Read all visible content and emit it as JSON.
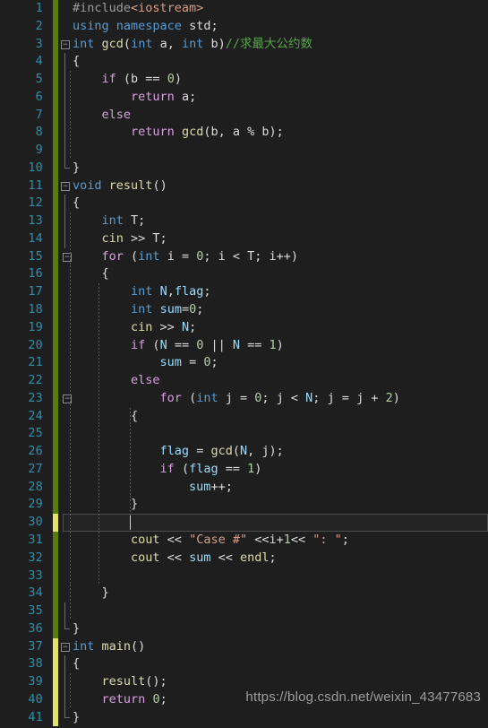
{
  "editor": {
    "first_line": 1,
    "last_line": 41,
    "total_lines": 41,
    "active_line": 30,
    "background": "#1e1e1e",
    "line_number_color": "#2b91af",
    "change_bar_saved_color": "#587c0c",
    "change_bar_unsaved_color": "#e2e26a"
  },
  "watermark": {
    "text": "https://blog.csdn.net/weixin_43477683"
  },
  "lines": [
    {
      "n": 1,
      "chg": "saved",
      "fold": "",
      "indent": 0,
      "tokens": [
        {
          "t": "#include",
          "c": "pre"
        },
        {
          "t": "<iostream>",
          "c": "inc"
        }
      ]
    },
    {
      "n": 2,
      "chg": "saved",
      "fold": "",
      "indent": 0,
      "tokens": [
        {
          "t": "using",
          "c": "kw"
        },
        {
          "t": " ",
          "c": "pun"
        },
        {
          "t": "namespace",
          "c": "kw"
        },
        {
          "t": " std;",
          "c": "pun"
        }
      ]
    },
    {
      "n": 3,
      "chg": "saved",
      "fold": "open",
      "indent": 0,
      "tokens": [
        {
          "t": "int",
          "c": "kw"
        },
        {
          "t": " ",
          "c": "pun"
        },
        {
          "t": "gcd",
          "c": "fn"
        },
        {
          "t": "(",
          "c": "pun"
        },
        {
          "t": "int",
          "c": "kw"
        },
        {
          "t": " a, ",
          "c": "pun"
        },
        {
          "t": "int",
          "c": "kw"
        },
        {
          "t": " b)",
          "c": "pun"
        },
        {
          "t": "//求最大公约数",
          "c": "cmt"
        }
      ]
    },
    {
      "n": 4,
      "chg": "saved",
      "fold": "bar",
      "indent": 0,
      "tokens": [
        {
          "t": "{",
          "c": "pun"
        }
      ]
    },
    {
      "n": 5,
      "chg": "saved",
      "fold": "bar",
      "indent": 1,
      "tokens": [
        {
          "t": "    ",
          "c": "pun"
        },
        {
          "t": "if",
          "c": "ctl"
        },
        {
          "t": " (b ",
          "c": "pun"
        },
        {
          "t": "==",
          "c": "pun"
        },
        {
          "t": " ",
          "c": "pun"
        },
        {
          "t": "0",
          "c": "num"
        },
        {
          "t": ")",
          "c": "pun"
        }
      ]
    },
    {
      "n": 6,
      "chg": "saved",
      "fold": "bar",
      "indent": 1,
      "tokens": [
        {
          "t": "        ",
          "c": "pun"
        },
        {
          "t": "return",
          "c": "ctl"
        },
        {
          "t": " a;",
          "c": "pun"
        }
      ]
    },
    {
      "n": 7,
      "chg": "saved",
      "fold": "bar",
      "indent": 1,
      "tokens": [
        {
          "t": "    ",
          "c": "pun"
        },
        {
          "t": "else",
          "c": "ctl"
        }
      ]
    },
    {
      "n": 8,
      "chg": "saved",
      "fold": "bar",
      "indent": 1,
      "tokens": [
        {
          "t": "        ",
          "c": "pun"
        },
        {
          "t": "return",
          "c": "ctl"
        },
        {
          "t": " ",
          "c": "pun"
        },
        {
          "t": "gcd",
          "c": "fn"
        },
        {
          "t": "(b, a % b);",
          "c": "pun"
        }
      ]
    },
    {
      "n": 9,
      "chg": "saved",
      "fold": "bar",
      "indent": 1,
      "tokens": []
    },
    {
      "n": 10,
      "chg": "saved",
      "fold": "end",
      "indent": 0,
      "tokens": [
        {
          "t": "}",
          "c": "pun"
        }
      ]
    },
    {
      "n": 11,
      "chg": "saved",
      "fold": "open",
      "indent": 0,
      "tokens": [
        {
          "t": "void",
          "c": "kw"
        },
        {
          "t": " ",
          "c": "pun"
        },
        {
          "t": "result",
          "c": "fn"
        },
        {
          "t": "()",
          "c": "pun"
        }
      ]
    },
    {
      "n": 12,
      "chg": "saved",
      "fold": "bar",
      "indent": 0,
      "tokens": [
        {
          "t": "{",
          "c": "pun"
        }
      ]
    },
    {
      "n": 13,
      "chg": "saved",
      "fold": "bar",
      "indent": 1,
      "tokens": [
        {
          "t": "    ",
          "c": "pun"
        },
        {
          "t": "int",
          "c": "kw"
        },
        {
          "t": " T;",
          "c": "pun"
        }
      ]
    },
    {
      "n": 14,
      "chg": "saved",
      "fold": "bar",
      "indent": 1,
      "tokens": [
        {
          "t": "    ",
          "c": "pun"
        },
        {
          "t": "cin",
          "c": "fn"
        },
        {
          "t": " >> T;",
          "c": "pun"
        }
      ]
    },
    {
      "n": 15,
      "chg": "saved",
      "fold": "open2",
      "indent": 1,
      "tokens": [
        {
          "t": "    ",
          "c": "pun"
        },
        {
          "t": "for",
          "c": "ctl"
        },
        {
          "t": " (",
          "c": "pun"
        },
        {
          "t": "int",
          "c": "kw"
        },
        {
          "t": " i = ",
          "c": "pun"
        },
        {
          "t": "0",
          "c": "num"
        },
        {
          "t": "; i < T; i++)",
          "c": "pun"
        }
      ]
    },
    {
      "n": 16,
      "chg": "saved",
      "fold": "bar2",
      "indent": 1,
      "tokens": [
        {
          "t": "    ",
          "c": "pun"
        },
        {
          "t": "{",
          "c": "pun"
        }
      ]
    },
    {
      "n": 17,
      "chg": "saved",
      "fold": "bar2",
      "indent": 2,
      "tokens": [
        {
          "t": "        ",
          "c": "pun"
        },
        {
          "t": "int",
          "c": "kw"
        },
        {
          "t": " ",
          "c": "pun"
        },
        {
          "t": "N",
          "c": "var"
        },
        {
          "t": ",",
          "c": "pun"
        },
        {
          "t": "flag",
          "c": "var"
        },
        {
          "t": ";",
          "c": "pun"
        }
      ]
    },
    {
      "n": 18,
      "chg": "saved",
      "fold": "bar2",
      "indent": 2,
      "tokens": [
        {
          "t": "        ",
          "c": "pun"
        },
        {
          "t": "int",
          "c": "kw"
        },
        {
          "t": " ",
          "c": "pun"
        },
        {
          "t": "sum",
          "c": "var"
        },
        {
          "t": "=",
          "c": "pun"
        },
        {
          "t": "0",
          "c": "num"
        },
        {
          "t": ";",
          "c": "pun"
        }
      ]
    },
    {
      "n": 19,
      "chg": "saved",
      "fold": "bar2",
      "indent": 2,
      "tokens": [
        {
          "t": "        ",
          "c": "pun"
        },
        {
          "t": "cin",
          "c": "fn"
        },
        {
          "t": " >> ",
          "c": "pun"
        },
        {
          "t": "N",
          "c": "var"
        },
        {
          "t": ";",
          "c": "pun"
        }
      ]
    },
    {
      "n": 20,
      "chg": "saved",
      "fold": "bar2",
      "indent": 2,
      "tokens": [
        {
          "t": "        ",
          "c": "pun"
        },
        {
          "t": "if",
          "c": "ctl"
        },
        {
          "t": " (",
          "c": "pun"
        },
        {
          "t": "N",
          "c": "var"
        },
        {
          "t": " == ",
          "c": "pun"
        },
        {
          "t": "0",
          "c": "num"
        },
        {
          "t": " || ",
          "c": "pun"
        },
        {
          "t": "N",
          "c": "var"
        },
        {
          "t": " == ",
          "c": "pun"
        },
        {
          "t": "1",
          "c": "num"
        },
        {
          "t": ")",
          "c": "pun"
        }
      ]
    },
    {
      "n": 21,
      "chg": "saved",
      "fold": "bar2",
      "indent": 2,
      "tokens": [
        {
          "t": "            ",
          "c": "pun"
        },
        {
          "t": "sum",
          "c": "var"
        },
        {
          "t": " = ",
          "c": "pun"
        },
        {
          "t": "0",
          "c": "num"
        },
        {
          "t": ";",
          "c": "pun"
        }
      ]
    },
    {
      "n": 22,
      "chg": "saved",
      "fold": "bar2",
      "indent": 2,
      "tokens": [
        {
          "t": "        ",
          "c": "pun"
        },
        {
          "t": "else",
          "c": "ctl"
        }
      ]
    },
    {
      "n": 23,
      "chg": "saved",
      "fold": "open3",
      "indent": 2,
      "tokens": [
        {
          "t": "            ",
          "c": "pun"
        },
        {
          "t": "for",
          "c": "ctl"
        },
        {
          "t": " (",
          "c": "pun"
        },
        {
          "t": "int",
          "c": "kw"
        },
        {
          "t": " j = ",
          "c": "pun"
        },
        {
          "t": "0",
          "c": "num"
        },
        {
          "t": "; j < ",
          "c": "pun"
        },
        {
          "t": "N",
          "c": "var"
        },
        {
          "t": "; j = j + ",
          "c": "pun"
        },
        {
          "t": "2",
          "c": "num"
        },
        {
          "t": ")",
          "c": "pun"
        }
      ]
    },
    {
      "n": 24,
      "chg": "saved",
      "fold": "bar2",
      "indent": 3,
      "tokens": [
        {
          "t": "        ",
          "c": "pun"
        },
        {
          "t": "{",
          "c": "pun"
        }
      ]
    },
    {
      "n": 25,
      "chg": "saved",
      "fold": "bar2",
      "indent": 3,
      "tokens": []
    },
    {
      "n": 26,
      "chg": "saved",
      "fold": "bar2",
      "indent": 3,
      "tokens": [
        {
          "t": "            ",
          "c": "pun"
        },
        {
          "t": "flag",
          "c": "var"
        },
        {
          "t": " = ",
          "c": "pun"
        },
        {
          "t": "gcd",
          "c": "fn"
        },
        {
          "t": "(",
          "c": "pun"
        },
        {
          "t": "N",
          "c": "var"
        },
        {
          "t": ", j);",
          "c": "pun"
        }
      ]
    },
    {
      "n": 27,
      "chg": "saved",
      "fold": "bar2",
      "indent": 3,
      "tokens": [
        {
          "t": "            ",
          "c": "pun"
        },
        {
          "t": "if",
          "c": "ctl"
        },
        {
          "t": " (",
          "c": "pun"
        },
        {
          "t": "flag",
          "c": "var"
        },
        {
          "t": " == ",
          "c": "pun"
        },
        {
          "t": "1",
          "c": "num"
        },
        {
          "t": ")",
          "c": "pun"
        }
      ]
    },
    {
      "n": 28,
      "chg": "saved",
      "fold": "bar2",
      "indent": 3,
      "tokens": [
        {
          "t": "                ",
          "c": "pun"
        },
        {
          "t": "sum",
          "c": "var"
        },
        {
          "t": "++;",
          "c": "pun"
        }
      ]
    },
    {
      "n": 29,
      "chg": "saved",
      "fold": "bar2",
      "indent": 3,
      "tokens": [
        {
          "t": "        ",
          "c": "pun"
        },
        {
          "t": "}",
          "c": "pun"
        }
      ]
    },
    {
      "n": 30,
      "chg": "unsaved",
      "fold": "bar2",
      "indent": 3,
      "tokens": []
    },
    {
      "n": 31,
      "chg": "saved",
      "fold": "bar2",
      "indent": 2,
      "tokens": [
        {
          "t": "        ",
          "c": "pun"
        },
        {
          "t": "cout",
          "c": "fn"
        },
        {
          "t": " << ",
          "c": "pun"
        },
        {
          "t": "\"Case #\"",
          "c": "str"
        },
        {
          "t": " <<i+",
          "c": "pun"
        },
        {
          "t": "1",
          "c": "num"
        },
        {
          "t": "<< ",
          "c": "pun"
        },
        {
          "t": "\": \"",
          "c": "str"
        },
        {
          "t": ";",
          "c": "pun"
        }
      ]
    },
    {
      "n": 32,
      "chg": "saved",
      "fold": "bar2",
      "indent": 2,
      "tokens": [
        {
          "t": "        ",
          "c": "pun"
        },
        {
          "t": "cout",
          "c": "fn"
        },
        {
          "t": " << ",
          "c": "pun"
        },
        {
          "t": "sum",
          "c": "var"
        },
        {
          "t": " << ",
          "c": "pun"
        },
        {
          "t": "endl",
          "c": "fn"
        },
        {
          "t": ";",
          "c": "pun"
        }
      ]
    },
    {
      "n": 33,
      "chg": "saved",
      "fold": "bar2",
      "indent": 2,
      "tokens": []
    },
    {
      "n": 34,
      "chg": "saved",
      "fold": "end2",
      "indent": 1,
      "tokens": [
        {
          "t": "    ",
          "c": "pun"
        },
        {
          "t": "}",
          "c": "pun"
        }
      ]
    },
    {
      "n": 35,
      "chg": "saved",
      "fold": "bar",
      "indent": 1,
      "tokens": []
    },
    {
      "n": 36,
      "chg": "saved",
      "fold": "end",
      "indent": 0,
      "tokens": [
        {
          "t": "}",
          "c": "pun"
        }
      ]
    },
    {
      "n": 37,
      "chg": "unsaved",
      "fold": "open",
      "indent": 0,
      "tokens": [
        {
          "t": "int",
          "c": "kw"
        },
        {
          "t": " ",
          "c": "pun"
        },
        {
          "t": "main",
          "c": "fn"
        },
        {
          "t": "()",
          "c": "pun"
        }
      ]
    },
    {
      "n": 38,
      "chg": "unsaved",
      "fold": "bar",
      "indent": 0,
      "tokens": [
        {
          "t": "{",
          "c": "pun"
        }
      ]
    },
    {
      "n": 39,
      "chg": "unsaved",
      "fold": "bar",
      "indent": 1,
      "tokens": [
        {
          "t": "    ",
          "c": "pun"
        },
        {
          "t": "result",
          "c": "fn"
        },
        {
          "t": "();",
          "c": "pun"
        }
      ]
    },
    {
      "n": 40,
      "chg": "unsaved",
      "fold": "bar",
      "indent": 1,
      "tokens": [
        {
          "t": "    ",
          "c": "pun"
        },
        {
          "t": "return",
          "c": "ctl"
        },
        {
          "t": " ",
          "c": "pun"
        },
        {
          "t": "0",
          "c": "num"
        },
        {
          "t": ";",
          "c": "pun"
        }
      ]
    },
    {
      "n": 41,
      "chg": "unsaved",
      "fold": "end",
      "indent": 0,
      "tokens": [
        {
          "t": "}",
          "c": "pun"
        }
      ]
    }
  ]
}
